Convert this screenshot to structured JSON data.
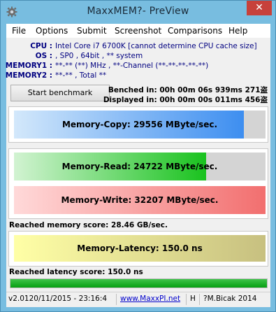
{
  "window": {
    "title": "MaxxMEM?- PreView",
    "close_glyph": "✕",
    "app_icon": "gear-icon"
  },
  "menu": {
    "items": [
      "File",
      "Options",
      "Submit",
      "Screenshot",
      "Comparisons",
      "Help"
    ]
  },
  "info": {
    "cpu_label": "CPU :",
    "cpu_value": "Intel Core i7 6700K  [cannot determine CPU cache size]",
    "os_label": "OS :",
    "os_value": ", SP0 , 64bit , ** system",
    "mem1_label": "MEMORY1 :",
    "mem1_value": "**-** (**) MHz , **-Channel (**-**-**-**-**)",
    "mem2_label": "MEMORY2 :",
    "mem2_value": "**-** , Total **"
  },
  "benchmark": {
    "start_label": "Start benchmark",
    "benched": "Benched in: 00h 00m 06s 939ms 271盗",
    "displayed": "Displayed in: 00h 00m 00s 011ms 456盗"
  },
  "results": {
    "copy": {
      "label": "Memory-Copy: 29556 MByte/sec.",
      "fill": 0.915,
      "color_start": "#d3e8fb",
      "color_end": "#3d8ef0"
    },
    "read": {
      "label": "Memory-Read: 24722 MByte/sec.",
      "fill": 0.765,
      "color_start": "#d2f3d2",
      "color_end": "#19c21e"
    },
    "write": {
      "label": "Memory-Write: 32207 MByte/sec.",
      "fill": 1.0,
      "color_start": "#ffd9d9",
      "color_end": "#f26f6f"
    },
    "latency": {
      "label": "Memory-Latency: 150.0 ns",
      "fill": 1.0,
      "color_start": "#ffffa6",
      "color_end": "#c7c080"
    }
  },
  "scores": {
    "memory": "Reached memory score: 28.46 GB/sec.",
    "latency": "Reached latency score: 150.0 ns"
  },
  "progress": {
    "value": 1.0
  },
  "status": {
    "version": "v2.0120/11/2015 - 23:16:4",
    "url": "www.MaxxPI.net",
    "hotkey": "H",
    "author": "?M.Bicak 2014"
  }
}
